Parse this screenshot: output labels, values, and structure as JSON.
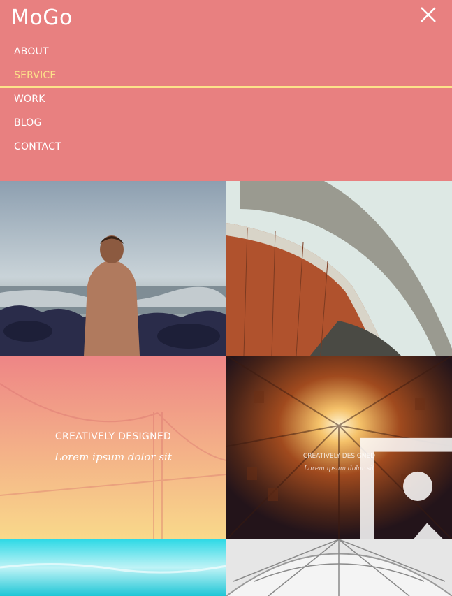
{
  "brand": {
    "logo": "MoGo"
  },
  "nav": {
    "items": [
      {
        "label": "ABOUT",
        "active": false
      },
      {
        "label": "SERVICE",
        "active": true
      },
      {
        "label": "WORK",
        "active": false
      },
      {
        "label": "BLOG",
        "active": false
      },
      {
        "label": "CONTACT",
        "active": false
      }
    ]
  },
  "colors": {
    "header_bg": "#e88080",
    "active_accent": "#fce38a"
  },
  "gallery": {
    "featured": {
      "title": "CREATIVELY DESIGNED",
      "subtitle": "Lorem ipsum dolor sit"
    },
    "hover": {
      "title": "CREATIVELY DESIGNED",
      "subtitle": "Lorem ipsum dolor sit",
      "icon": "image-icon"
    }
  }
}
